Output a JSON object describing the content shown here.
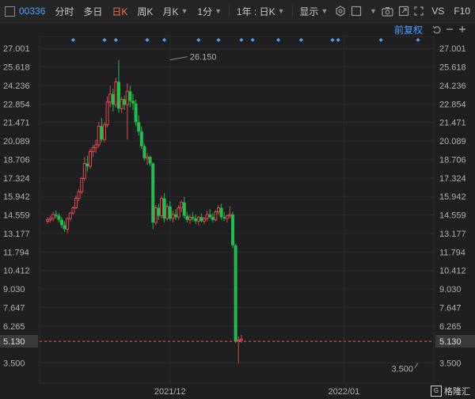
{
  "toolbar": {
    "code": "00336",
    "timeshare": "分时",
    "multiday": "多日",
    "day_k": "日K",
    "week_k": "周K",
    "month_k": "月K",
    "minute": "1分",
    "range": "1年 : 日K",
    "display": "显示",
    "vs": "VS",
    "f10": "F10"
  },
  "subbar": {
    "adjust": "前复权"
  },
  "watermark": {
    "text": "格隆汇"
  },
  "colors": {
    "up": "#e04a4a",
    "down": "#1fbf4b",
    "accent": "#ff6a3d",
    "blue": "#4aa3ff"
  },
  "chart_data": {
    "type": "candlestick",
    "y_ticks": [
      "27.001",
      "25.618",
      "24.236",
      "22.854",
      "21.471",
      "20.089",
      "18.706",
      "17.324",
      "15.942",
      "14.559",
      "13.177",
      "11.794",
      "10.412",
      "9.030",
      "7.647",
      "6.265",
      "3.500"
    ],
    "ylim": [
      2.0,
      27.9
    ],
    "x_tick_labels": [
      {
        "label": "2021/12",
        "index": 43
      },
      {
        "label": "2022/01",
        "index": 104
      }
    ],
    "current_price": "5.130",
    "high_annotation": {
      "label": "26.150",
      "value": 26.15,
      "index": 43
    },
    "low_annotation": {
      "label": "3.500",
      "value": 3.5,
      "index": 130
    },
    "event_marker_indices": [
      9,
      20,
      24,
      35,
      41,
      53,
      60,
      68,
      72,
      81,
      89,
      100,
      102,
      117,
      130
    ],
    "candles": [
      {
        "o": 14.1,
        "h": 14.4,
        "l": 13.9,
        "c": 14.2
      },
      {
        "o": 14.2,
        "h": 14.5,
        "l": 14.0,
        "c": 14.3
      },
      {
        "o": 14.3,
        "h": 14.8,
        "l": 14.1,
        "c": 14.6
      },
      {
        "o": 14.6,
        "h": 14.9,
        "l": 14.3,
        "c": 14.5
      },
      {
        "o": 14.5,
        "h": 14.7,
        "l": 14.0,
        "c": 14.2
      },
      {
        "o": 14.2,
        "h": 14.4,
        "l": 13.6,
        "c": 13.8
      },
      {
        "o": 13.8,
        "h": 14.1,
        "l": 13.3,
        "c": 13.5
      },
      {
        "o": 13.5,
        "h": 14.4,
        "l": 13.2,
        "c": 14.3
      },
      {
        "o": 14.3,
        "h": 14.8,
        "l": 14.1,
        "c": 14.7
      },
      {
        "o": 14.7,
        "h": 15.2,
        "l": 14.6,
        "c": 15.1
      },
      {
        "o": 15.1,
        "h": 16.0,
        "l": 15.0,
        "c": 15.8
      },
      {
        "o": 15.8,
        "h": 16.5,
        "l": 15.6,
        "c": 16.3
      },
      {
        "o": 16.3,
        "h": 17.4,
        "l": 16.1,
        "c": 17.3
      },
      {
        "o": 17.3,
        "h": 18.9,
        "l": 17.1,
        "c": 18.4
      },
      {
        "o": 18.4,
        "h": 19.0,
        "l": 17.8,
        "c": 18.2
      },
      {
        "o": 18.2,
        "h": 19.5,
        "l": 18.0,
        "c": 19.3
      },
      {
        "o": 19.3,
        "h": 19.8,
        "l": 18.9,
        "c": 19.6
      },
      {
        "o": 19.6,
        "h": 20.2,
        "l": 19.2,
        "c": 19.8
      },
      {
        "o": 19.8,
        "h": 21.5,
        "l": 19.6,
        "c": 21.2
      },
      {
        "o": 21.2,
        "h": 21.8,
        "l": 20.0,
        "c": 20.2
      },
      {
        "o": 20.2,
        "h": 21.5,
        "l": 20.0,
        "c": 21.3
      },
      {
        "o": 21.3,
        "h": 23.4,
        "l": 21.1,
        "c": 23.0
      },
      {
        "o": 23.0,
        "h": 24.2,
        "l": 22.6,
        "c": 23.6
      },
      {
        "o": 23.6,
        "h": 24.0,
        "l": 22.3,
        "c": 22.8
      },
      {
        "o": 22.8,
        "h": 24.8,
        "l": 22.6,
        "c": 24.5
      },
      {
        "o": 24.5,
        "h": 26.15,
        "l": 22.2,
        "c": 22.5
      },
      {
        "o": 22.5,
        "h": 23.4,
        "l": 22.2,
        "c": 23.2
      },
      {
        "o": 23.2,
        "h": 23.5,
        "l": 22.4,
        "c": 22.8
      },
      {
        "o": 22.8,
        "h": 24.4,
        "l": 20.2,
        "c": 23.8
      },
      {
        "o": 23.8,
        "h": 24.2,
        "l": 22.6,
        "c": 23.1
      },
      {
        "o": 23.1,
        "h": 23.6,
        "l": 22.4,
        "c": 22.9
      },
      {
        "o": 22.9,
        "h": 23.2,
        "l": 21.2,
        "c": 21.5
      },
      {
        "o": 21.5,
        "h": 22.0,
        "l": 20.5,
        "c": 20.8
      },
      {
        "o": 20.8,
        "h": 21.2,
        "l": 19.5,
        "c": 19.7
      },
      {
        "o": 19.7,
        "h": 19.9,
        "l": 18.6,
        "c": 18.8
      },
      {
        "o": 18.8,
        "h": 19.2,
        "l": 18.3,
        "c": 18.9
      },
      {
        "o": 18.9,
        "h": 19.0,
        "l": 18.2,
        "c": 18.4
      },
      {
        "o": 18.4,
        "h": 18.5,
        "l": 13.5,
        "c": 14.0
      },
      {
        "o": 14.0,
        "h": 15.3,
        "l": 13.8,
        "c": 15.1
      },
      {
        "o": 15.1,
        "h": 15.4,
        "l": 14.2,
        "c": 14.5
      },
      {
        "o": 14.5,
        "h": 16.0,
        "l": 14.3,
        "c": 15.8
      },
      {
        "o": 15.8,
        "h": 16.2,
        "l": 14.0,
        "c": 14.3
      },
      {
        "o": 14.3,
        "h": 15.4,
        "l": 14.1,
        "c": 15.2
      },
      {
        "o": 15.2,
        "h": 15.6,
        "l": 14.1,
        "c": 14.3
      },
      {
        "o": 14.3,
        "h": 14.9,
        "l": 14.0,
        "c": 14.6
      },
      {
        "o": 14.6,
        "h": 15.0,
        "l": 14.2,
        "c": 14.4
      },
      {
        "o": 14.4,
        "h": 15.3,
        "l": 14.2,
        "c": 15.1
      },
      {
        "o": 15.1,
        "h": 15.7,
        "l": 14.8,
        "c": 15.5
      },
      {
        "o": 15.5,
        "h": 15.9,
        "l": 14.3,
        "c": 14.5
      },
      {
        "o": 14.5,
        "h": 14.8,
        "l": 14.0,
        "c": 14.2
      },
      {
        "o": 14.2,
        "h": 14.6,
        "l": 13.9,
        "c": 14.4
      },
      {
        "o": 14.4,
        "h": 14.8,
        "l": 14.1,
        "c": 14.3
      },
      {
        "o": 14.3,
        "h": 14.6,
        "l": 13.9,
        "c": 14.1
      },
      {
        "o": 14.1,
        "h": 14.5,
        "l": 13.8,
        "c": 14.4
      },
      {
        "o": 14.4,
        "h": 14.7,
        "l": 14.0,
        "c": 14.1
      },
      {
        "o": 14.1,
        "h": 14.4,
        "l": 13.9,
        "c": 14.3
      },
      {
        "o": 14.3,
        "h": 14.9,
        "l": 14.1,
        "c": 14.6
      },
      {
        "o": 14.6,
        "h": 15.0,
        "l": 14.3,
        "c": 14.4
      },
      {
        "o": 14.4,
        "h": 14.7,
        "l": 14.0,
        "c": 14.2
      },
      {
        "o": 14.2,
        "h": 14.9,
        "l": 14.1,
        "c": 14.8
      },
      {
        "o": 14.8,
        "h": 15.3,
        "l": 14.6,
        "c": 15.1
      },
      {
        "o": 15.1,
        "h": 15.4,
        "l": 14.2,
        "c": 14.4
      },
      {
        "o": 14.4,
        "h": 14.8,
        "l": 14.1,
        "c": 14.3
      },
      {
        "o": 14.3,
        "h": 14.6,
        "l": 14.0,
        "c": 14.5
      },
      {
        "o": 14.5,
        "h": 15.2,
        "l": 14.3,
        "c": 14.6
      },
      {
        "o": 14.6,
        "h": 14.8,
        "l": 12.1,
        "c": 12.3
      },
      {
        "o": 12.3,
        "h": 12.4,
        "l": 5.0,
        "c": 5.13
      },
      {
        "o": 5.13,
        "h": 5.5,
        "l": 3.5,
        "c": 5.2
      },
      {
        "o": 5.2,
        "h": 5.6,
        "l": 5.0,
        "c": 5.3
      }
    ]
  }
}
